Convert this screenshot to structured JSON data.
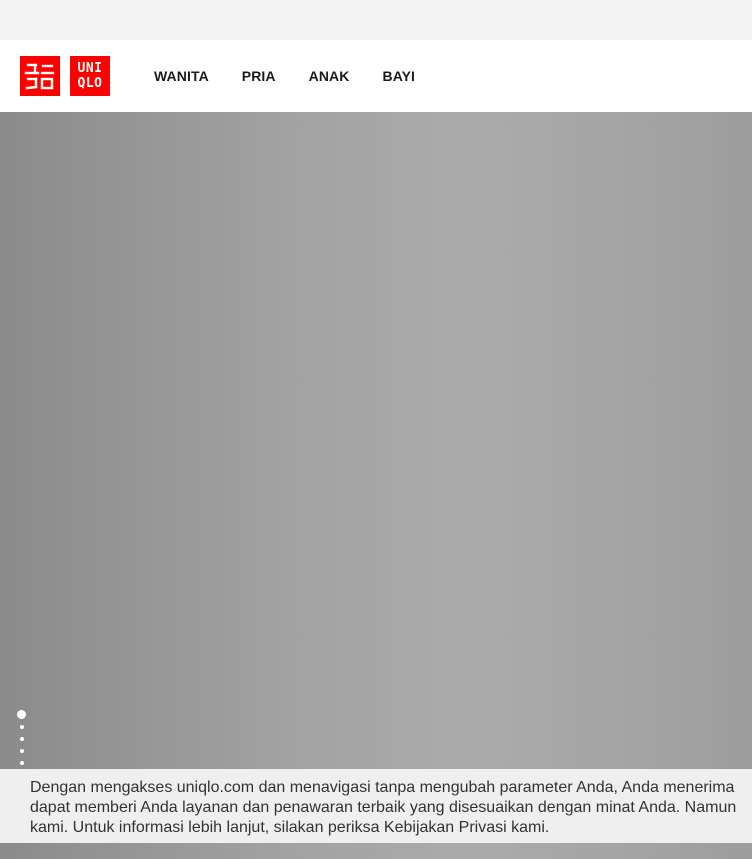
{
  "brand": {
    "name": "UNIQLO",
    "logo_katakana": "ユニクロ",
    "logo_latin_line1": "UNI",
    "logo_latin_line2": "QLO",
    "color": "#ff0000"
  },
  "nav": {
    "items": [
      {
        "label": "WANITA"
      },
      {
        "label": "PRIA"
      },
      {
        "label": "ANAK"
      },
      {
        "label": "BAYI"
      }
    ]
  },
  "hero": {
    "slide_count": 6,
    "active_slide": 1
  },
  "cookie_banner": {
    "line1": "Dengan mengakses uniqlo.com dan menavigasi tanpa mengubah parameter Anda, Anda menerima",
    "line2": "dapat memberi Anda layanan dan penawaran terbaik yang disesuaikan dengan minat Anda. Namun",
    "line3": "kami. Untuk informasi lebih lanjut, silakan periksa Kebijakan Privasi kami."
  }
}
